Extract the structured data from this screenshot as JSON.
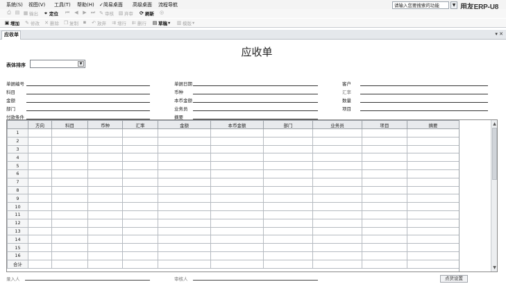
{
  "menu": {
    "items": [
      "系统(S)",
      "视图(V)",
      "工具(T)",
      "帮助(H)",
      "简易桌面",
      "高级桌面",
      "流程导航"
    ],
    "search_text": "请输入您要搜索的功能",
    "brand": "用友ERP-U8"
  },
  "toolbar1": {
    "print": "打印",
    "preview": "预览",
    "output": "输出",
    "locate": "定位",
    "audit": "审核",
    "abandon": "弃审",
    "refresh": "刷新"
  },
  "toolbar2": {
    "add": "增加",
    "modify": "修改",
    "delete": "删除",
    "copy": "复制",
    "abandon": "放弃",
    "add_row": "增行",
    "del_row": "删行",
    "draft": "草稿",
    "template": "模版"
  },
  "tab": {
    "label": "应收单"
  },
  "form": {
    "title": "应收单",
    "sort_label": "表体排序",
    "sort_value": "",
    "fields": {
      "bill_no": "单据编号",
      "bill_date": "单据日期",
      "customer": "客户",
      "subject": "科目",
      "currency": "币种",
      "rate": "汇率",
      "amount": "金额",
      "local_amount": "本币金额",
      "quantity": "数量",
      "department": "部门",
      "salesman": "业务员",
      "project": "项目",
      "pay_terms": "付款条件",
      "summary": "摘要"
    }
  },
  "grid": {
    "columns": [
      "方向",
      "科目",
      "币种",
      "汇率",
      "金额",
      "本币金额",
      "部门",
      "业务员",
      "项目",
      "摘要"
    ],
    "rows": [
      "1",
      "2",
      "3",
      "4",
      "5",
      "6",
      "7",
      "8",
      "9",
      "10",
      "11",
      "12",
      "13",
      "14",
      "15",
      "16"
    ],
    "total_label": "合计"
  },
  "footer": {
    "entered_by": "录入人",
    "audited_by": "审核人",
    "print_settings": "点货设置"
  }
}
